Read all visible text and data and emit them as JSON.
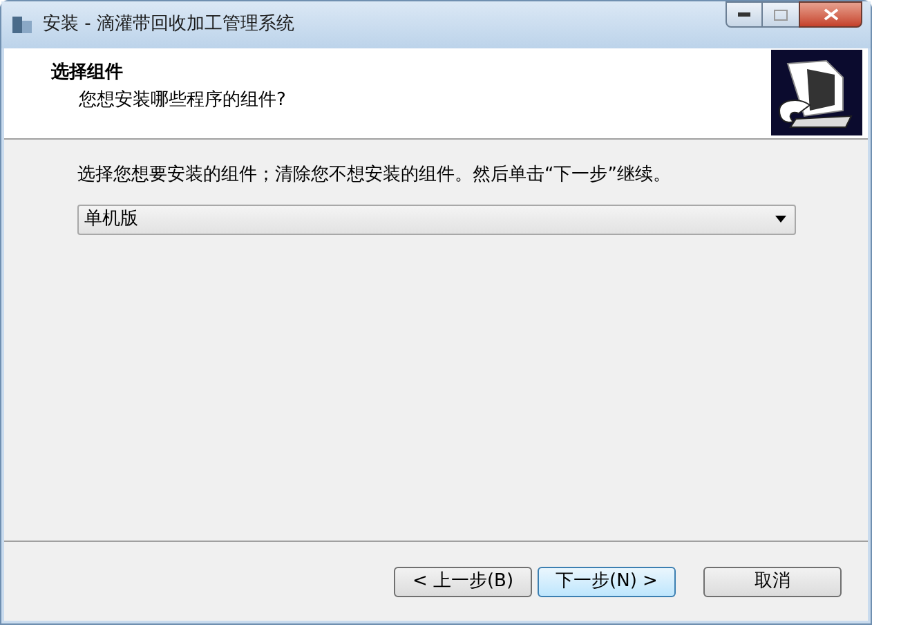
{
  "window": {
    "title": "安装 - 滴灌带回收加工管理系统"
  },
  "header": {
    "title": "选择组件",
    "subtitle": "您想安装哪些程序的组件?"
  },
  "instruction": "选择您想要安装的组件；清除您不想安装的组件。然后单击“下一步”继续。",
  "dropdown": {
    "value": "单机版"
  },
  "buttons": [
    {
      "label": "< 上一步(B)",
      "selected": false
    },
    {
      "label": "下一步(N) >",
      "selected": true
    },
    {
      "label": "取消",
      "selected": false
    }
  ]
}
